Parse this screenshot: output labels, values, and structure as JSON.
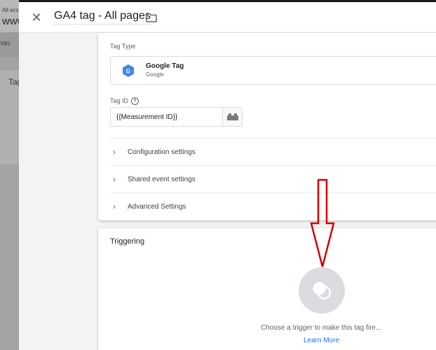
{
  "background": {
    "account_small": "All acc",
    "account_big": "www",
    "nav_text": "min",
    "tag_text": "Tag"
  },
  "header": {
    "close_icon": "close-icon",
    "title": "GA4 tag - All pages",
    "folder_icon": "folder-icon"
  },
  "config": {
    "tag_type_label": "Tag Type",
    "tag_type_name": "Google Tag",
    "tag_type_vendor": "Google",
    "tag_id_label": "Tag ID",
    "tag_id_help": "?",
    "tag_id_value": "{{Measurement ID}}",
    "sections": [
      {
        "label": "Configuration settings"
      },
      {
        "label": "Shared event settings"
      },
      {
        "label": "Advanced Settings"
      }
    ]
  },
  "triggering": {
    "title": "Triggering",
    "message": "Choose a trigger to make this tag fire...",
    "learn_more": "Learn More"
  },
  "colors": {
    "accent": "#1a73e8",
    "annotation_arrow": "#d50000",
    "google_tag_blue": "#4285f4"
  }
}
